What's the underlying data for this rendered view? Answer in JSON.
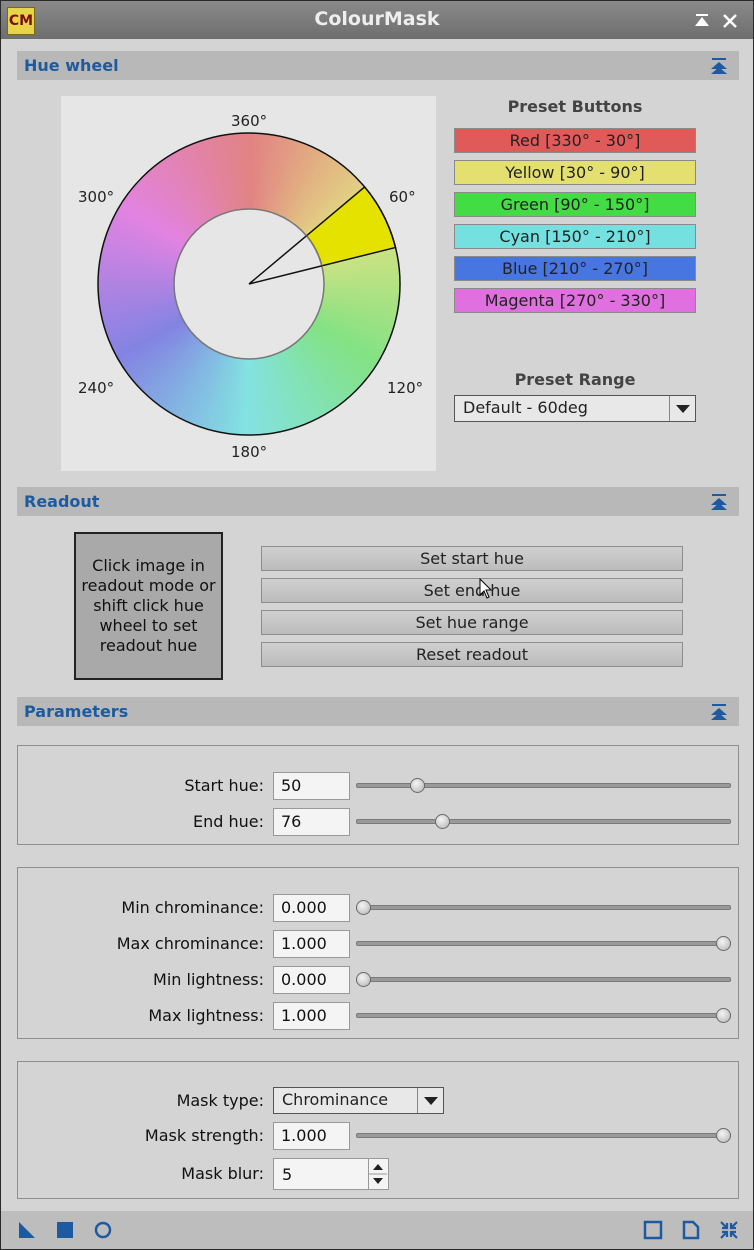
{
  "window": {
    "icon_text": "CM",
    "title": "ColourMask"
  },
  "hue_wheel": {
    "section_label": "Hue wheel",
    "tick_labels": {
      "t360": "360°",
      "t60": "60°",
      "t120": "120°",
      "t180": "180°",
      "t240": "240°",
      "t300": "300°"
    },
    "selection": {
      "start_deg": 50,
      "end_deg": 76,
      "highlight_color": "#e6e200"
    },
    "preset_title": "Preset Buttons",
    "presets": [
      {
        "label": "Red [330° - 30°]",
        "color": "#e05a5a"
      },
      {
        "label": "Yellow [30° - 90°]",
        "color": "#e4e070"
      },
      {
        "label": "Green [90° - 150°]",
        "color": "#44dc44"
      },
      {
        "label": "Cyan [150° - 210°]",
        "color": "#74e0e0"
      },
      {
        "label": "Blue [210° - 270°]",
        "color": "#4876e0"
      },
      {
        "label": "Magenta [270° - 330°]",
        "color": "#e070e0"
      }
    ],
    "range_title": "Preset Range",
    "range_value": "Default - 60deg"
  },
  "readout": {
    "section_label": "Readout",
    "box_text": "Click image in readout mode or shift click hue wheel to set readout hue",
    "buttons": [
      "Set start hue",
      "Set end hue",
      "Set hue range",
      "Reset readout"
    ]
  },
  "parameters": {
    "section_label": "Parameters",
    "start_hue": {
      "label": "Start hue:",
      "value": "50",
      "fraction": 0.15
    },
    "end_hue": {
      "label": "End hue:",
      "value": "76",
      "fraction": 0.22
    },
    "min_chrominance": {
      "label": "Min chrominance:",
      "value": "0.000",
      "fraction": 0.0
    },
    "max_chrominance": {
      "label": "Max chrominance:",
      "value": "1.000",
      "fraction": 1.0
    },
    "min_lightness": {
      "label": "Min lightness:",
      "value": "0.000",
      "fraction": 0.0
    },
    "max_lightness": {
      "label": "Max lightness:",
      "value": "1.000",
      "fraction": 1.0
    },
    "mask_type": {
      "label": "Mask type:",
      "value": "Chrominance"
    },
    "mask_strength": {
      "label": "Mask strength:",
      "value": "1.000",
      "fraction": 1.0
    },
    "mask_blur": {
      "label": "Mask blur:",
      "value": "5"
    }
  },
  "colors": {
    "section_label": "#1e5aa0",
    "accent_icon": "#1e5aa0"
  }
}
